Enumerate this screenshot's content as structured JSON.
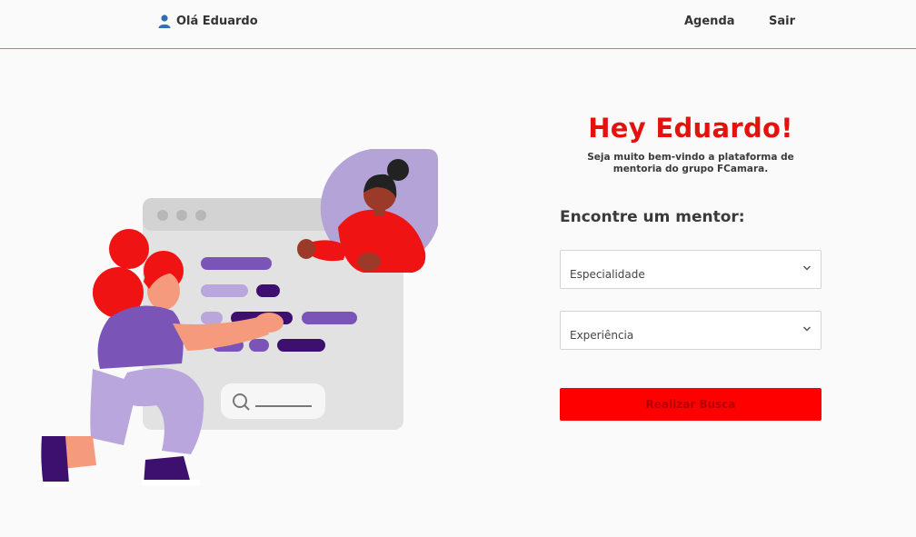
{
  "header": {
    "greeting": "Olá Eduardo",
    "nav": {
      "agenda": "Agenda",
      "logout": "Sair"
    },
    "border_color": "#e86a4f"
  },
  "hero": {
    "title": "Hey Eduardo!",
    "subtitle_line1": "Seja muito bem-vindo a plataforma de",
    "subtitle_line2": "mentoria do grupo FCamara.",
    "accent_color": "#e3120f"
  },
  "form": {
    "title": "Encontre um mentor:",
    "specialty": {
      "selected": "Especialidade"
    },
    "experience": {
      "selected": "Experiência"
    },
    "search_button": "Realizar Busca",
    "button_color": "#ff0000"
  },
  "icons": {
    "user": "user-icon",
    "dropdown": "chevron-down-icon",
    "search": "search-icon"
  }
}
